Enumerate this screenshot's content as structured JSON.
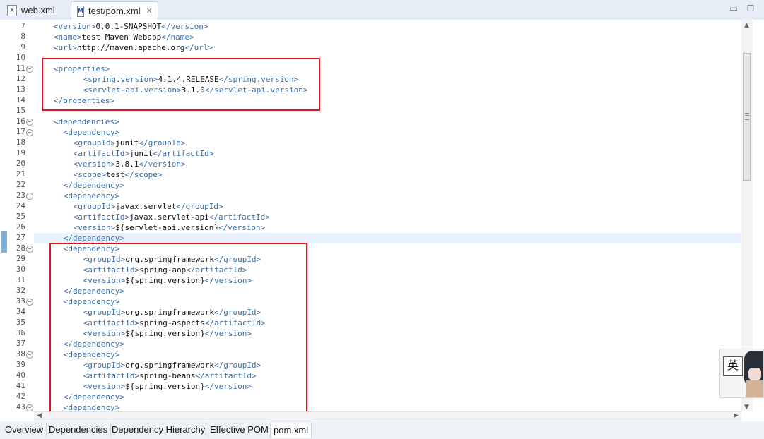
{
  "tabs": [
    {
      "label": "web.xml",
      "icon": "xml-file-icon",
      "closable": false
    },
    {
      "label": "test/pom.xml",
      "icon": "maven-pom-icon",
      "closable": true
    }
  ],
  "window_controls": {
    "minimize": "▭",
    "maximize": "☐"
  },
  "editor": {
    "current_line": 27,
    "lines": [
      {
        "n": "7",
        "ind": 2,
        "fold": false,
        "parts": [
          [
            "tag",
            "<version>"
          ],
          [
            "txt",
            "0.0.1-SNAPSHOT"
          ],
          [
            "tag",
            "</version>"
          ]
        ]
      },
      {
        "n": "8",
        "ind": 2,
        "fold": false,
        "parts": [
          [
            "tag",
            "<name>"
          ],
          [
            "txt",
            "test Maven Webapp"
          ],
          [
            "tag",
            "</name>"
          ]
        ]
      },
      {
        "n": "9",
        "ind": 2,
        "fold": false,
        "parts": [
          [
            "tag",
            "<url>"
          ],
          [
            "txt",
            "http://maven.apache.org"
          ],
          [
            "tag",
            "</url>"
          ]
        ]
      },
      {
        "n": "10",
        "ind": 0,
        "fold": false,
        "parts": []
      },
      {
        "n": "11",
        "ind": 2,
        "fold": true,
        "parts": [
          [
            "tag",
            "<properties>"
          ]
        ]
      },
      {
        "n": "12",
        "ind": 8,
        "fold": false,
        "parts": [
          [
            "tag",
            "<spring.version>"
          ],
          [
            "txt",
            "4.1.4.RELEASE"
          ],
          [
            "tag",
            "</spring.version>"
          ]
        ]
      },
      {
        "n": "13",
        "ind": 8,
        "fold": false,
        "parts": [
          [
            "tag",
            "<servlet-api.version>"
          ],
          [
            "txt",
            "3.1.0"
          ],
          [
            "tag",
            "</servlet-api.version>"
          ]
        ]
      },
      {
        "n": "14",
        "ind": 2,
        "fold": false,
        "parts": [
          [
            "tag",
            "</properties>"
          ]
        ]
      },
      {
        "n": "15",
        "ind": 0,
        "fold": false,
        "parts": []
      },
      {
        "n": "16",
        "ind": 2,
        "fold": true,
        "parts": [
          [
            "tag",
            "<dependencies>"
          ]
        ]
      },
      {
        "n": "17",
        "ind": 4,
        "fold": true,
        "parts": [
          [
            "tag",
            "<dependency>"
          ]
        ]
      },
      {
        "n": "18",
        "ind": 6,
        "fold": false,
        "parts": [
          [
            "tag",
            "<groupId>"
          ],
          [
            "txt",
            "junit"
          ],
          [
            "tag",
            "</groupId>"
          ]
        ]
      },
      {
        "n": "19",
        "ind": 6,
        "fold": false,
        "parts": [
          [
            "tag",
            "<artifactId>"
          ],
          [
            "txt",
            "junit"
          ],
          [
            "tag",
            "</artifactId>"
          ]
        ]
      },
      {
        "n": "20",
        "ind": 6,
        "fold": false,
        "parts": [
          [
            "tag",
            "<version>"
          ],
          [
            "txt",
            "3.8.1"
          ],
          [
            "tag",
            "</version>"
          ]
        ]
      },
      {
        "n": "21",
        "ind": 6,
        "fold": false,
        "parts": [
          [
            "tag",
            "<scope>"
          ],
          [
            "txt",
            "test"
          ],
          [
            "tag",
            "</scope>"
          ]
        ]
      },
      {
        "n": "22",
        "ind": 4,
        "fold": false,
        "parts": [
          [
            "tag",
            "</dependency>"
          ]
        ]
      },
      {
        "n": "23",
        "ind": 4,
        "fold": true,
        "parts": [
          [
            "tag",
            "<dependency>"
          ]
        ]
      },
      {
        "n": "24",
        "ind": 6,
        "fold": false,
        "parts": [
          [
            "tag",
            "<groupId>"
          ],
          [
            "txt",
            "javax.servlet"
          ],
          [
            "tag",
            "</groupId>"
          ]
        ]
      },
      {
        "n": "25",
        "ind": 6,
        "fold": false,
        "parts": [
          [
            "tag",
            "<artifactId>"
          ],
          [
            "txt",
            "javax.servlet-api"
          ],
          [
            "tag",
            "</artifactId>"
          ]
        ]
      },
      {
        "n": "26",
        "ind": 6,
        "fold": false,
        "parts": [
          [
            "tag",
            "<version>"
          ],
          [
            "txt",
            "${servlet-api.version}"
          ],
          [
            "tag",
            "</version>"
          ]
        ]
      },
      {
        "n": "27",
        "ind": 4,
        "fold": false,
        "parts": [
          [
            "tag",
            "</dependency>"
          ]
        ]
      },
      {
        "n": "28",
        "ind": 4,
        "fold": true,
        "parts": [
          [
            "tag",
            "<dependency>"
          ]
        ]
      },
      {
        "n": "29",
        "ind": 8,
        "fold": false,
        "parts": [
          [
            "tag",
            "<groupId>"
          ],
          [
            "txt",
            "org.springframework"
          ],
          [
            "tag",
            "</groupId>"
          ]
        ]
      },
      {
        "n": "30",
        "ind": 8,
        "fold": false,
        "parts": [
          [
            "tag",
            "<artifactId>"
          ],
          [
            "txt",
            "spring-aop"
          ],
          [
            "tag",
            "</artifactId>"
          ]
        ]
      },
      {
        "n": "31",
        "ind": 8,
        "fold": false,
        "parts": [
          [
            "tag",
            "<version>"
          ],
          [
            "txt",
            "${spring.version}"
          ],
          [
            "tag",
            "</version>"
          ]
        ]
      },
      {
        "n": "32",
        "ind": 4,
        "fold": false,
        "parts": [
          [
            "tag",
            "</dependency>"
          ]
        ]
      },
      {
        "n": "33",
        "ind": 4,
        "fold": true,
        "parts": [
          [
            "tag",
            "<dependency>"
          ]
        ]
      },
      {
        "n": "34",
        "ind": 8,
        "fold": false,
        "parts": [
          [
            "tag",
            "<groupId>"
          ],
          [
            "txt",
            "org.springframework"
          ],
          [
            "tag",
            "</groupId>"
          ]
        ]
      },
      {
        "n": "35",
        "ind": 8,
        "fold": false,
        "parts": [
          [
            "tag",
            "<artifactId>"
          ],
          [
            "txt",
            "spring-aspects"
          ],
          [
            "tag",
            "</artifactId>"
          ]
        ]
      },
      {
        "n": "36",
        "ind": 8,
        "fold": false,
        "parts": [
          [
            "tag",
            "<version>"
          ],
          [
            "txt",
            "${spring.version}"
          ],
          [
            "tag",
            "</version>"
          ]
        ]
      },
      {
        "n": "37",
        "ind": 4,
        "fold": false,
        "parts": [
          [
            "tag",
            "</dependency>"
          ]
        ]
      },
      {
        "n": "38",
        "ind": 4,
        "fold": true,
        "parts": [
          [
            "tag",
            "<dependency>"
          ]
        ]
      },
      {
        "n": "39",
        "ind": 8,
        "fold": false,
        "parts": [
          [
            "tag",
            "<groupId>"
          ],
          [
            "txt",
            "org.springframework"
          ],
          [
            "tag",
            "</groupId>"
          ]
        ]
      },
      {
        "n": "40",
        "ind": 8,
        "fold": false,
        "parts": [
          [
            "tag",
            "<artifactId>"
          ],
          [
            "txt",
            "spring-beans"
          ],
          [
            "tag",
            "</artifactId>"
          ]
        ]
      },
      {
        "n": "41",
        "ind": 8,
        "fold": false,
        "parts": [
          [
            "tag",
            "<version>"
          ],
          [
            "txt",
            "${spring.version}"
          ],
          [
            "tag",
            "</version>"
          ]
        ]
      },
      {
        "n": "42",
        "ind": 4,
        "fold": false,
        "parts": [
          [
            "tag",
            "</dependency>"
          ]
        ]
      },
      {
        "n": "43",
        "ind": 4,
        "fold": true,
        "parts": [
          [
            "tag",
            "<dependency>"
          ]
        ]
      }
    ]
  },
  "bottom_tabs": [
    {
      "label": "Overview",
      "active": false
    },
    {
      "label": "Dependencies",
      "active": false
    },
    {
      "label": "Dependency Hierarchy",
      "active": false
    },
    {
      "label": "Effective POM",
      "active": false
    },
    {
      "label": "pom.xml",
      "active": true
    }
  ],
  "avatar_char": "英",
  "colors": {
    "tag": "#3a6fa8",
    "text": "#111111",
    "highlight_box": "#e0141e",
    "current_line": "#e8f2fe"
  }
}
